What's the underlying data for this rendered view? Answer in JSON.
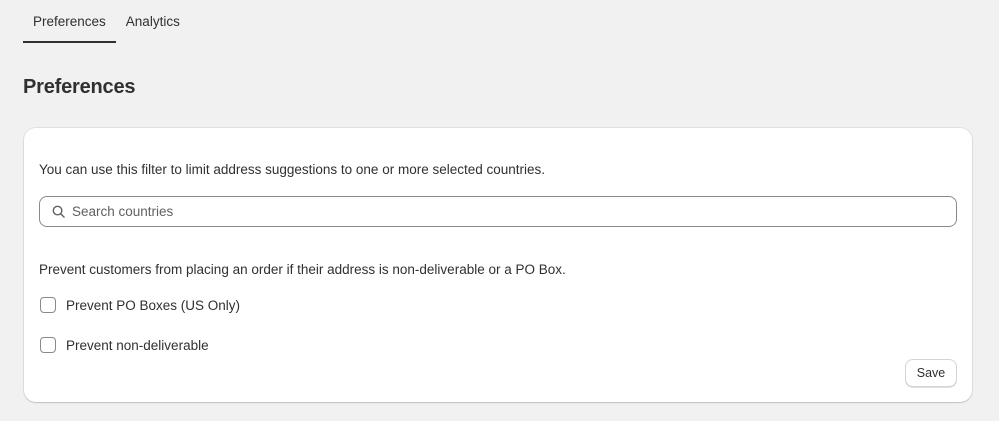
{
  "tabs": [
    {
      "label": "Preferences",
      "active": true
    },
    {
      "label": "Analytics",
      "active": false
    }
  ],
  "page_title": "Preferences",
  "card": {
    "filter_description": "You can use this filter to limit address suggestions to one or more selected countries.",
    "search": {
      "placeholder": "Search countries",
      "value": ""
    },
    "prevent_description": "Prevent customers from placing an order if their address is non-deliverable or a PO Box.",
    "checkboxes": [
      {
        "label": "Prevent PO Boxes (US Only)",
        "checked": false
      },
      {
        "label": "Prevent non-deliverable",
        "checked": false
      }
    ],
    "save_label": "Save"
  },
  "icons": {
    "search": "search-icon"
  },
  "colors": {
    "background": "#f1f1f1",
    "card": "#ffffff",
    "text": "#303030",
    "border": "#8a8a8a"
  }
}
